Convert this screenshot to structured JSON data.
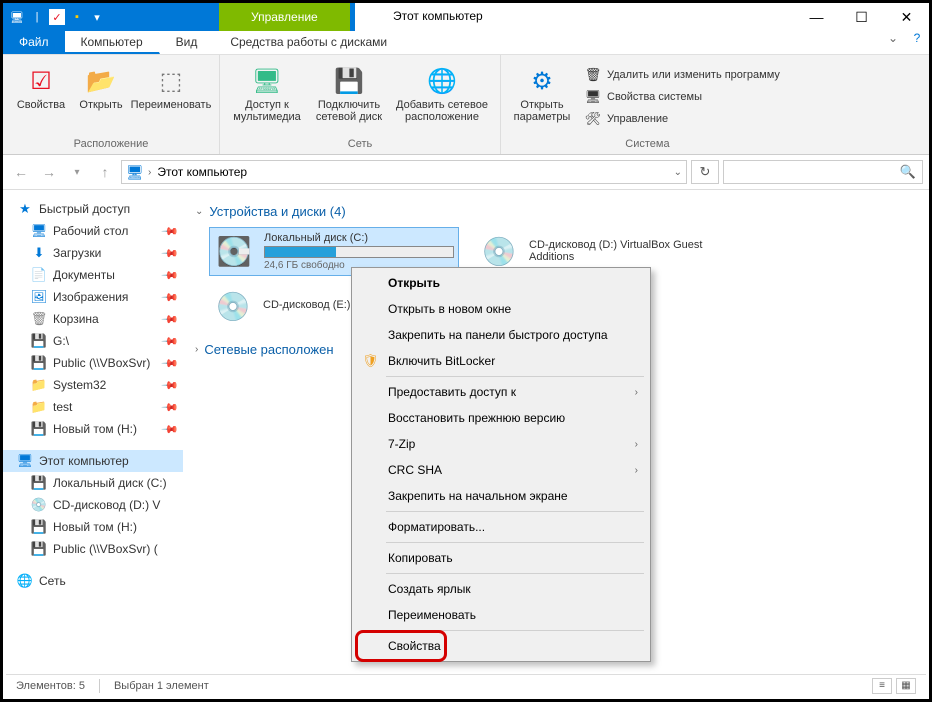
{
  "titlebar": {
    "context_tab": "Управление",
    "title": "Этот компьютер"
  },
  "menu": {
    "file": "Файл",
    "computer": "Компьютер",
    "view": "Вид",
    "disks": "Средства работы с дисками"
  },
  "ribbon": {
    "properties": "Свойства",
    "open": "Открыть",
    "rename": "Переименовать",
    "group_location": "Расположение",
    "media_access": "Доступ к мультимедиа",
    "map_drive": "Подключить сетевой диск",
    "add_network": "Добавить сетевое расположение",
    "group_network": "Сеть",
    "open_params": "Открыть параметры",
    "uninstall": "Удалить или изменить программу",
    "sys_props": "Свойства системы",
    "manage": "Управление",
    "group_system": "Система"
  },
  "nav": {
    "location": "Этот компьютер"
  },
  "sidebar": {
    "quick_access": "Быстрый доступ",
    "desktop": "Рабочий стол",
    "downloads": "Загрузки",
    "documents": "Документы",
    "pictures": "Изображения",
    "trash": "Корзина",
    "g_drive": "G:\\",
    "public": "Public (\\\\VBoxSvr)",
    "system32": "System32",
    "test": "test",
    "new_vol": "Новый том (H:)",
    "this_pc": "Этот компьютер",
    "local_c": "Локальный диск (C:)",
    "cd_d": "CD-дисковод (D:) V",
    "new_h": "Новый том (H:)",
    "public2": "Public (\\\\VBoxSvr) (",
    "network": "Сеть"
  },
  "main": {
    "section_drives": "Устройства и диски (4)",
    "drive_c_name": "Локальный диск (C:)",
    "drive_c_free": "24,6 ГБ свободно",
    "drive_d_name": "CD-дисковод (D:) VirtualBox Guest Additions",
    "drive_e_name": "CD-дисковод (E:)",
    "section_network": "Сетевые расположен"
  },
  "context_menu": {
    "open": "Открыть",
    "open_new": "Открыть в новом окне",
    "pin_qa": "Закрепить на панели быстрого доступа",
    "bitlocker": "Включить BitLocker",
    "share": "Предоставить доступ к",
    "restore": "Восстановить прежнюю версию",
    "sevenzip": "7-Zip",
    "crc": "CRC SHA",
    "pin_start": "Закрепить на начальном экране",
    "format": "Форматировать...",
    "copy": "Копировать",
    "shortcut": "Создать ярлык",
    "rename": "Переименовать",
    "properties": "Свойства"
  },
  "statusbar": {
    "elements": "Элементов: 5",
    "selected": "Выбран 1 элемент"
  }
}
